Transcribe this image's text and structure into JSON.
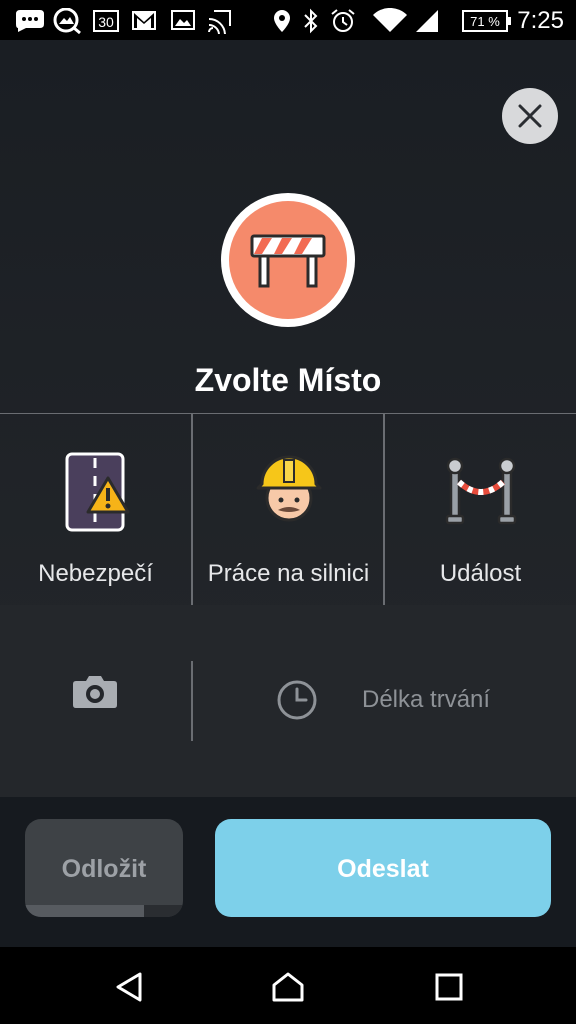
{
  "status_bar": {
    "time": "7:25",
    "battery_percent": "71 %",
    "calendar_day": "30",
    "icons": [
      "message-icon",
      "photo-app-icon",
      "calendar-icon",
      "gmail-icon",
      "gallery-icon",
      "cast-icon",
      "location-icon",
      "bluetooth-icon",
      "alarm-icon",
      "wifi-icon",
      "signal-icon",
      "battery-icon"
    ]
  },
  "dialog": {
    "title": "Zvolte Místo",
    "hero_icon": "road-barrier-icon",
    "close_icon": "close-icon"
  },
  "options": [
    {
      "label": "Nebezpečí",
      "icon": "hazard-icon"
    },
    {
      "label": "Práce na silnici",
      "icon": "road-worker-icon"
    },
    {
      "label": "Událost",
      "icon": "event-rope-icon"
    }
  ],
  "extras": {
    "camera_icon": "camera-icon",
    "duration_icon": "clock-icon",
    "duration_label": "Délka trvání"
  },
  "actions": {
    "later_label": "Odložit",
    "later_progress": 0.75,
    "send_label": "Odeslat"
  },
  "colors": {
    "accent_send": "#7dd0ea",
    "hero_circle": "#f58a6b",
    "background": "#1b1f24"
  },
  "nav_bar": [
    "back-icon",
    "home-icon",
    "recents-icon"
  ]
}
